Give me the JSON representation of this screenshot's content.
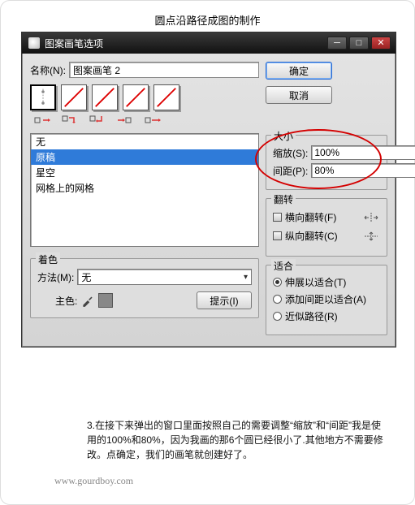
{
  "page_title": "圆点沿路径成图的制作",
  "dialog": {
    "title": "图案画笔选项",
    "name_label": "名称(N):",
    "name_value": "图案画笔 2",
    "ok": "确定",
    "cancel": "取消"
  },
  "list": {
    "items": [
      "无",
      "原稿",
      "星空",
      "网格上的网格"
    ],
    "selected_index": 1
  },
  "size": {
    "legend": "大小",
    "scale_label": "缩放(S):",
    "scale_value": "100%",
    "spacing_label": "间距(P):",
    "spacing_value": "80%"
  },
  "flip": {
    "legend": "翻转",
    "h_label": "横向翻转(F)",
    "v_label": "纵向翻转(C)"
  },
  "fit": {
    "legend": "适合",
    "stretch": "伸展以适合(T)",
    "addspace": "添加间距以适合(A)",
    "approx": "近似路径(R)",
    "selected": "stretch"
  },
  "tint": {
    "legend": "着色",
    "method_label": "方法(M):",
    "method_value": "无",
    "key_label": "主色:",
    "tips_label": "提示(I)"
  },
  "footnote": "3.在接下来弹出的窗口里面按照自己的需要调整“缩放”和“间距”我是使用的100%和80%，因为我画的那6个圆已经很小了.其他地方不需要修改。点确定，我们的画笔就创建好了。",
  "watermark": "www.gourdboy.com"
}
